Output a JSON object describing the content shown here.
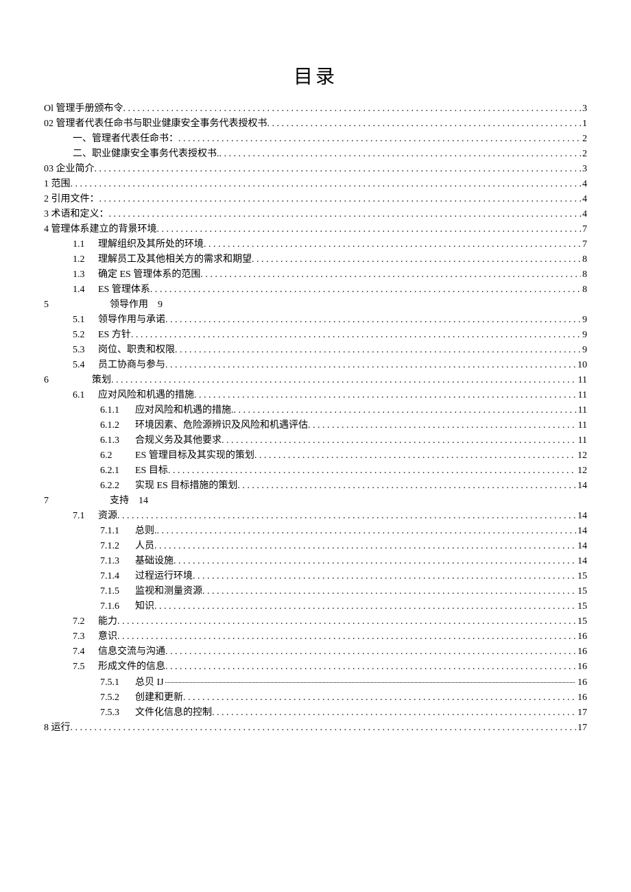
{
  "title": "目录",
  "entries": [
    {
      "level": 0,
      "label": "Ol 管理手册颁布令",
      "page": "3",
      "leader": true
    },
    {
      "level": 0,
      "label": "02 管理者代表任命书与职业健康安全事务代表授权书",
      "page": "1",
      "leader": true
    },
    {
      "level": 1,
      "num": "",
      "label": "一、管理者代表任命书：",
      "page": "2",
      "leader": true
    },
    {
      "level": 1,
      "num": "",
      "label": "二、职业健康安全事务代表授权书.",
      "page": "2",
      "leader": true
    },
    {
      "level": 0,
      "label": "03 企业简介",
      "page": "3",
      "leader": true
    },
    {
      "level": 0,
      "label": "1 范围",
      "page": "4",
      "leader": true
    },
    {
      "level": 0,
      "label": "2 引用文件：",
      "page": "4",
      "leader": true
    },
    {
      "level": 0,
      "label": "3 术语和定义：",
      "page": "4",
      "leader": true
    },
    {
      "level": 0,
      "label": "4 管理体系建立的背景环境",
      "page": "7",
      "leader": true
    },
    {
      "level": 1,
      "num": "1.1",
      "label": "理解组织及其所处的环境",
      "page": "7",
      "leader": true
    },
    {
      "level": 1,
      "num": "1.2",
      "label": "理解员工及其他相关方的需求和期望",
      "page": "8",
      "leader": true
    },
    {
      "level": 1,
      "num": "1.3",
      "label": "确定 ES 管理体系的范围",
      "page": "8",
      "leader": true
    },
    {
      "level": 1,
      "num": "1.4",
      "label": "ES 管理体系",
      "page": "8",
      "leader": true
    },
    {
      "level": "chapter",
      "chapter_num": "5",
      "label": "领导作用",
      "tail": "9",
      "leader": false
    },
    {
      "level": 1,
      "num": "5.1",
      "label": "领导作用与承诺",
      "page": "9",
      "leader": true
    },
    {
      "level": 1,
      "num": "5.2",
      "label": "ES 方针",
      "page": "9",
      "leader": true
    },
    {
      "level": 1,
      "num": "5.3",
      "label": "岗位、职责和权限",
      "page": "9",
      "leader": true
    },
    {
      "level": 1,
      "num": "5.4",
      "label": "员工协商与参与",
      "page": "10",
      "leader": true
    },
    {
      "level": "chapter-leader",
      "chapter_num": "6",
      "label": "策划",
      "page": "11",
      "leader": true
    },
    {
      "level": 1,
      "num": "6.1",
      "label": "应对风险和机遇的措施",
      "page": "11",
      "leader": true
    },
    {
      "level": 2,
      "num": "6.1.1",
      "label": "应对风险和机遇的措施.",
      "page": "11",
      "leader": true
    },
    {
      "level": 2,
      "num": "6.1.2",
      "label": "环境因素、危险源辨识及风险和机遇评估",
      "page": "11",
      "leader": true
    },
    {
      "level": 2,
      "num": "6.1.3",
      "label": "合规义务及其他要求",
      "page": "11",
      "leader": true
    },
    {
      "level": 2,
      "num": "6.2",
      "label": "ES 管理目标及其实现的策划",
      "page": "12",
      "leader": true
    },
    {
      "level": 2,
      "num": "6.2.1",
      "label": "ES 目标",
      "page": "12",
      "leader": true
    },
    {
      "level": 2,
      "num": "6.2.2",
      "label": "实现 ES 目标措施的策划",
      "page": "14",
      "leader": true
    },
    {
      "level": "chapter",
      "chapter_num": "7",
      "label": "支持",
      "tail": "14",
      "leader": false
    },
    {
      "level": 1,
      "num": "7.1",
      "label": "资源",
      "page": "14",
      "leader": true
    },
    {
      "level": 2,
      "num": "7.1.1",
      "label": "总则.",
      "page": "14",
      "leader": true
    },
    {
      "level": 2,
      "num": "7.1.2",
      "label": "人员",
      "page": "14",
      "leader": true
    },
    {
      "level": 2,
      "num": "7.1.3",
      "label": "基础设施",
      "page": "14",
      "leader": true
    },
    {
      "level": 2,
      "num": "7.1.4",
      "label": "过程运行环境",
      "page": "15",
      "leader": true
    },
    {
      "level": 2,
      "num": "7.1.5",
      "label": "监视和测量资源",
      "page": "15",
      "leader": true
    },
    {
      "level": 2,
      "num": "7.1.6",
      "label": "知识",
      "page": "15",
      "leader": true
    },
    {
      "level": 1,
      "num": "7.2",
      "label": "能力",
      "page": "15",
      "leader": true
    },
    {
      "level": 1,
      "num": "7.3",
      "label": "意识",
      "page": "16",
      "leader": true
    },
    {
      "level": 1,
      "num": "7.4",
      "label": "信息交流与沟通",
      "page": "16",
      "leader": true
    },
    {
      "level": 1,
      "num": "7.5",
      "label": "形成文件的信息",
      "page": "16",
      "leader": true
    },
    {
      "level": 2,
      "num": "7.5.1",
      "label": "总贝 IJ",
      "page": "16",
      "leader": true,
      "leader_style": "dense"
    },
    {
      "level": 2,
      "num": "7.5.2",
      "label": "创建和更新",
      "page": "16",
      "leader": true
    },
    {
      "level": 2,
      "num": "7.5.3",
      "label": "文件化信息的控制",
      "page": "17",
      "leader": true
    },
    {
      "level": 0,
      "label": "8 运行",
      "page": "17",
      "leader": true
    }
  ]
}
